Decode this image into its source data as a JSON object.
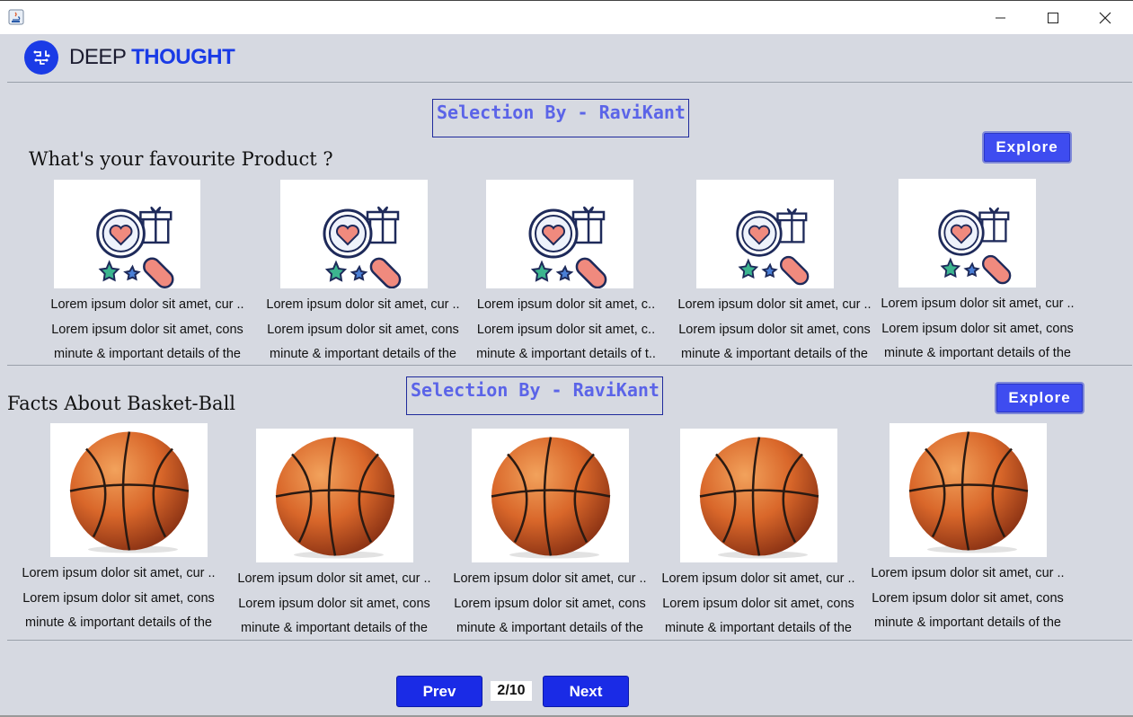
{
  "window": {
    "minimize_glyph": "—",
    "maximize_glyph": "☐",
    "close_glyph": "✕"
  },
  "brand": {
    "name_part1": "DEEP ",
    "name_part2": "THOUGHT",
    "accent": "#1a3be6"
  },
  "sections": [
    {
      "selection_label": "Selection By - RaviKant",
      "title": "What's your favourite Product ?",
      "explore_label": "Explore",
      "image_icon": "product-search-icon",
      "cards": [
        {
          "line1": "Lorem ipsum dolor sit amet, cur ..",
          "line2": "Lorem ipsum dolor sit amet, cons",
          "line3": "minute & important details of the"
        },
        {
          "line1": "Lorem ipsum dolor sit amet, cur ..",
          "line2": "Lorem ipsum dolor sit amet, cons",
          "line3": "minute & important details of the"
        },
        {
          "line1": "Lorem ipsum dolor sit amet, c..",
          "line2": "Lorem ipsum dolor sit amet, c..",
          "line3": "minute & important details of t.."
        },
        {
          "line1": "Lorem ipsum dolor sit amet, cur ..",
          "line2": "Lorem ipsum dolor sit amet, cons",
          "line3": "minute & important details of the"
        },
        {
          "line1": "Lorem ipsum dolor sit amet, cur ..",
          "line2": "Lorem ipsum dolor sit amet, cons",
          "line3": "minute & important details of the"
        }
      ]
    },
    {
      "selection_label": "Selection By - RaviKant",
      "title": "Facts About Basket-Ball",
      "explore_label": "Explore",
      "image_icon": "basketball-icon",
      "cards": [
        {
          "line1": "Lorem ipsum dolor sit amet, cur ..",
          "line2": "Lorem ipsum dolor sit amet, cons",
          "line3": "minute & important details of the"
        },
        {
          "line1": "Lorem ipsum dolor sit amet, cur ..",
          "line2": "Lorem ipsum dolor sit amet, cons",
          "line3": "minute & important details of the"
        },
        {
          "line1": "Lorem ipsum dolor sit amet, cur ..",
          "line2": "Lorem ipsum dolor sit amet, cons",
          "line3": "minute & important details of the"
        },
        {
          "line1": "Lorem ipsum dolor sit amet, cur ..",
          "line2": "Lorem ipsum dolor sit amet, cons",
          "line3": "minute & important details of the"
        },
        {
          "line1": "Lorem ipsum dolor sit amet, cur ..",
          "line2": "Lorem ipsum dolor sit amet, cons",
          "line3": "minute & important details of the"
        }
      ]
    }
  ],
  "pagination": {
    "prev_label": "Prev",
    "next_label": "Next",
    "page_indicator": "2/10"
  }
}
